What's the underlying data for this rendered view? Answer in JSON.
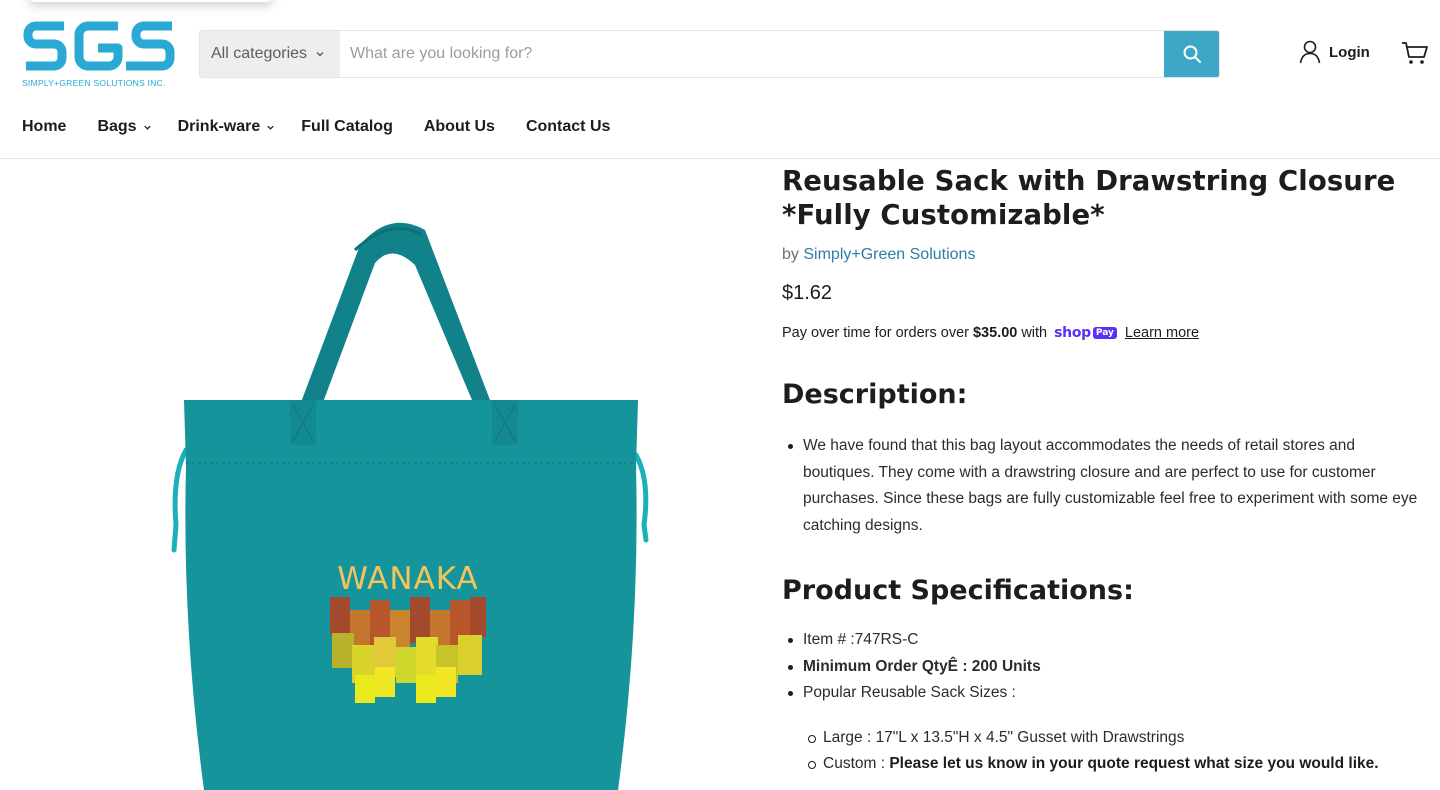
{
  "brand": {
    "logo_text": "SGS",
    "tagline": "SIMPLY+GREEN SOLUTIONS INC.",
    "color": "#2aa9d4"
  },
  "search": {
    "category_label": "All categories",
    "placeholder": "What are you looking for?",
    "button_color": "#3ea7c7"
  },
  "account": {
    "login_label": "Login"
  },
  "nav": {
    "items": [
      {
        "label": "Home"
      },
      {
        "label": "Bags"
      },
      {
        "label": "Drink-ware"
      },
      {
        "label": "Full Catalog"
      },
      {
        "label": "About Us"
      },
      {
        "label": "Contact Us"
      }
    ]
  },
  "product": {
    "image_text": "WANAKA",
    "title_line1": "Reusable Sack with Drawstring Closure",
    "title_line2": "*Fully Customizable*",
    "vendor_prefix": "by",
    "vendor": "Simply+Green Solutions",
    "price": "$1.62",
    "installments": {
      "prefix": "Pay over time for orders over",
      "amount": "$35.00",
      "suffix": "with",
      "provider_word": "shop",
      "provider_pill": "Pay",
      "learn_more": "Learn more"
    },
    "description_heading": "Description:",
    "description": [
      "We have found that this bag layout accommodates the needs of retail stores and boutiques. They come with a drawstring closure and are perfect to use for customer purchases. Since these bags are fully customizable feel free to experiment with some eye catching designs."
    ],
    "specs_heading": "Product Specifications:",
    "specs": {
      "item": "Item # :747RS-C",
      "min_order": "Minimum Order QtyÊ : 200 Units",
      "sizes_label": "Popular Reusable Sack Sizes :",
      "sizes": [
        {
          "label": "Large : ",
          "value": "17\"L x 13.5\"H x 4.5\" Gusset with Drawstrings"
        },
        {
          "label": "Custom : ",
          "value": "Please let us know in your quote request what size you would like."
        }
      ]
    }
  },
  "colors": {
    "bag": "#16949c",
    "link": "#2c7ea5",
    "shop_pay": "#5a31f4"
  }
}
